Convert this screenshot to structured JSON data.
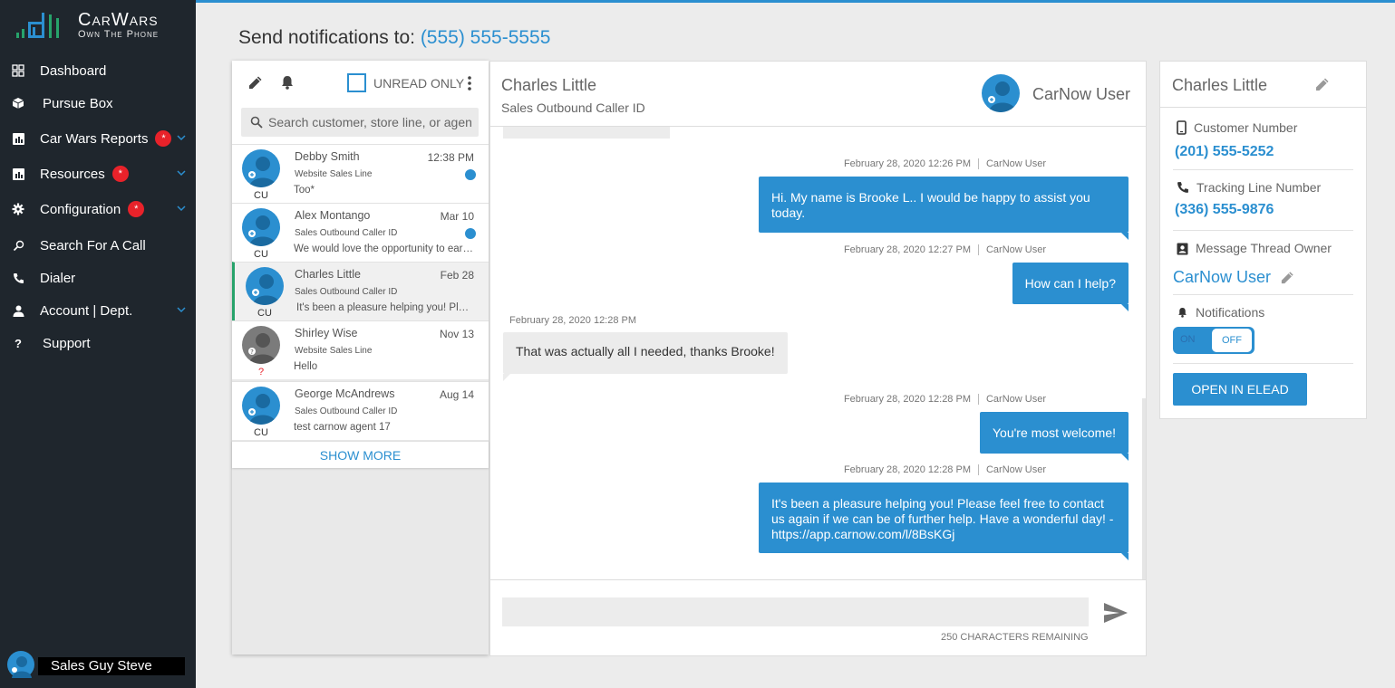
{
  "brand": {
    "name": "CarWars",
    "tagline": "Own The Phone"
  },
  "sidebar": {
    "items": [
      {
        "label": "Dashboard",
        "icon": "dashboard-icon"
      },
      {
        "label": "Pursue Box",
        "icon": "box-icon"
      },
      {
        "label": "Car Wars Reports",
        "icon": "reports-icon",
        "badge": "*",
        "expandable": true
      },
      {
        "label": "Resources",
        "icon": "resources-icon",
        "badge": "*",
        "expandable": true
      },
      {
        "label": "Configuration",
        "icon": "gear-icon",
        "badge": "*",
        "expandable": true
      },
      {
        "label": "Search For A Call",
        "icon": "search-icon"
      },
      {
        "label": "Dialer",
        "icon": "phone-icon"
      },
      {
        "label": "Account | Dept.",
        "icon": "person-icon",
        "expandable": true
      },
      {
        "label": "Support",
        "icon": "question-icon"
      }
    ],
    "user": "Sales Guy Steve"
  },
  "header": {
    "send_label": "Send notifications to:",
    "phone": "(555) 555-5555"
  },
  "conversations": {
    "unread_label": "UNREAD ONLY",
    "search_placeholder": "Search customer, store line, or agent",
    "items": [
      {
        "name": "Debby Smith",
        "line": "Website Sales Line",
        "preview": "Too*",
        "date": "12:38 PM",
        "initials": "CU",
        "unread": true
      },
      {
        "name": "Alex Montango",
        "line": "Sales Outbound Caller ID",
        "preview": "We would love the opportunity to earn your business",
        "date": "Mar 10",
        "initials": "CU",
        "unread": true
      },
      {
        "name": "Charles Little",
        "line": "Sales Outbound Caller ID",
        "preview": "It's been a pleasure helping you! Please feel free",
        "date": "Feb 28",
        "initials": "CU",
        "unread": false,
        "active": true
      },
      {
        "name": "Shirley Wise",
        "line": "Website Sales Line",
        "preview": "Hello",
        "date": "Nov 13",
        "initials": "?",
        "unread": false
      },
      {
        "name": "George McAndrews",
        "line": "Sales Outbound Caller ID",
        "preview": "test carnow agent 17",
        "date": "Aug 14",
        "initials": "CU",
        "unread": false
      }
    ],
    "show_more": "SHOW MORE"
  },
  "chat": {
    "contact": "Charles Little",
    "line": "Sales Outbound Caller ID",
    "agent": "CarNow User",
    "messages": [
      {
        "dir": "out",
        "time": "February 28, 2020 12:26 PM",
        "sender": "CarNow User",
        "text": "Hi. My name is Brooke L.. I would be happy to assist you today."
      },
      {
        "dir": "out",
        "time": "February 28, 2020 12:27 PM",
        "sender": "CarNow User",
        "text": "How can I help?"
      },
      {
        "dir": "in",
        "time": "February 28, 2020 12:28 PM",
        "text": "That was actually all I needed, thanks Brooke!"
      },
      {
        "dir": "out",
        "time": "February 28, 2020 12:28 PM",
        "sender": "CarNow User",
        "text": "You're most welcome!"
      },
      {
        "dir": "out",
        "time": "February 28, 2020 12:28 PM",
        "sender": "CarNow User",
        "text": "It's been a pleasure helping you! Please feel free to contact us again if we can be of further help. Have a wonderful day! - https://app.carnow.com/l/8BsKGj"
      }
    ],
    "remaining": "250 CHARACTERS REMAINING"
  },
  "details": {
    "name": "Charles Little",
    "customer_number_label": "Customer Number",
    "customer_number": "(201) 555-5252",
    "tracking_label": "Tracking Line Number",
    "tracking_number": "(336) 555-9876",
    "owner_label": "Message Thread Owner",
    "owner": "CarNow User",
    "notifications_label": "Notifications",
    "toggle_on": "ON",
    "toggle_off": "OFF",
    "notifications_state": "off",
    "open_button": "OPEN IN ELEAD"
  },
  "colors": {
    "accent": "#2b8fd0",
    "sidebar": "#1f262d",
    "badge": "#e8222a",
    "active_border": "#27a36b"
  }
}
